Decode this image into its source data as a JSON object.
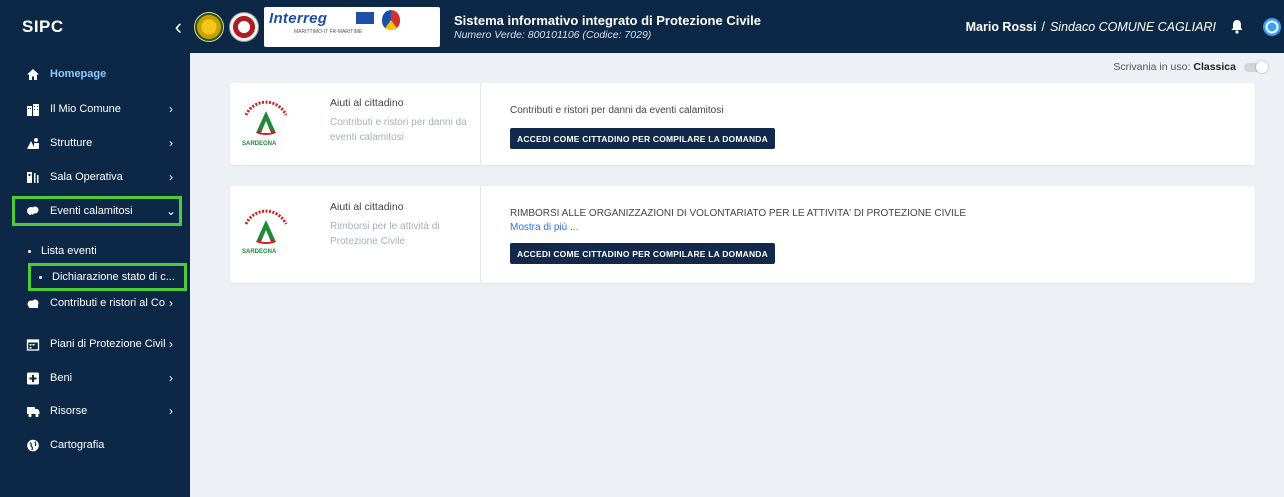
{
  "header": {
    "brand": "SIPC",
    "collapse_icon": "chevron-left-icon",
    "title": "Sistema informativo integrato di Protezione Civile",
    "subtitle": "Numero Verde: 800101106 (Codice: 7029)",
    "interreg_label": "Interreg",
    "interreg_sub": "MARITTIMO-IT FR-MARITIME",
    "user_name": "Mario Rossi",
    "separator": "/",
    "user_role": "Sindaco COMUNE CAGLIARI"
  },
  "sidebar": {
    "items": [
      {
        "label": "Homepage",
        "icon": "home-icon"
      },
      {
        "label": "Il Mio Comune",
        "icon": "building-icon"
      },
      {
        "label": "Strutture",
        "icon": "structures-icon"
      },
      {
        "label": "Sala Operativa",
        "icon": "operations-room-icon"
      },
      {
        "label": "Eventi calamitosi",
        "icon": "disaster-icon"
      },
      {
        "label": "Contributi e ristori al Co...",
        "icon": "cloud-icon"
      },
      {
        "label": "Piani di Protezione Civile",
        "icon": "calendar-icon"
      },
      {
        "label": "Beni",
        "icon": "plus-square-icon"
      },
      {
        "label": "Risorse",
        "icon": "truck-icon"
      },
      {
        "label": "Cartografia",
        "icon": "globe-icon"
      }
    ],
    "subitems": [
      {
        "label": "Lista eventi"
      },
      {
        "label": "Dichiarazione stato di c..."
      }
    ]
  },
  "desk": {
    "label": "Scrivania in uso:",
    "value": "Classica"
  },
  "cards": [
    {
      "logo_text": "SARDEGNA",
      "left_title": "Aiuti al cittadino",
      "left_sub": "Contributi e ristori per danni da eventi calamitosi",
      "right_text": "Contributi e ristori per danni da eventi calamitosi",
      "more": "",
      "button": "ACCEDI COME CITTADINO PER COMPILARE LA DOMANDA"
    },
    {
      "logo_text": "SARDEGNA",
      "left_title": "Aiuti al cittadino",
      "left_sub": "Rimborsi per le attività di Protezione Civile",
      "right_text": "RIMBORSI ALLE ORGANIZZAZIONI DI VOLONTARIATO PER LE ATTIVITA' DI PROTEZIONE CIVILE",
      "more": "Mostra di più ...",
      "button": "ACCEDI COME CITTADINO PER COMPILARE LA DOMANDA"
    }
  ],
  "colors": {
    "sidebar_bg": "#0c2846",
    "highlight": "#4dcc3a",
    "button_bg": "#13294b",
    "link": "#2b72d4"
  }
}
